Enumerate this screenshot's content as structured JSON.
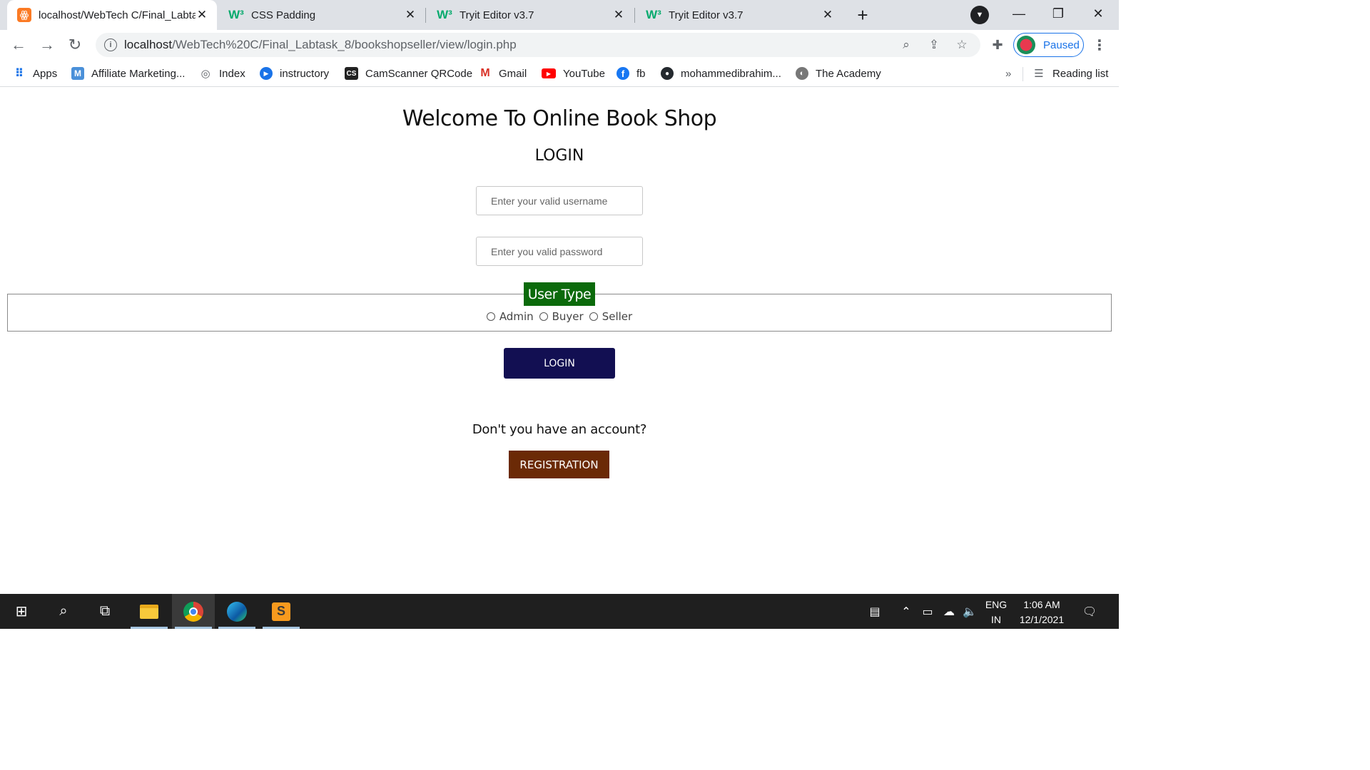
{
  "tabs": [
    {
      "title": "localhost/WebTech C/Final_Labta",
      "favicon": "xampp-icon",
      "active": true
    },
    {
      "title": "CSS Padding",
      "favicon": "w3schools-icon",
      "active": false
    },
    {
      "title": "Tryit Editor v3.7",
      "favicon": "w3schools-icon",
      "active": false
    },
    {
      "title": "Tryit Editor v3.7",
      "favicon": "w3schools-icon",
      "active": false
    }
  ],
  "toolbar": {
    "url_host": "localhost",
    "url_path": "/WebTech%20C/Final_Labtask_8/bookshopseller/view/login.php",
    "profile_label": "Paused"
  },
  "bookmarks": [
    {
      "label": "Apps",
      "icon": "apps-grid-icon"
    },
    {
      "label": "Affiliate Marketing...",
      "icon": "m-icon"
    },
    {
      "label": "Index",
      "icon": "globe-icon"
    },
    {
      "label": "instructory",
      "icon": "play-icon"
    },
    {
      "label": "CamScanner QRCode",
      "icon": "cs-icon"
    },
    {
      "label": "Gmail",
      "icon": "gmail-icon"
    },
    {
      "label": "YouTube",
      "icon": "youtube-icon"
    },
    {
      "label": "fb",
      "icon": "facebook-icon"
    },
    {
      "label": "mohammedibrahim...",
      "icon": "github-icon"
    },
    {
      "label": "The Academy",
      "icon": "globe-icon"
    }
  ],
  "reading_list": "Reading list",
  "page": {
    "welcome": "Welcome To Online Book Shop",
    "login_title": "LOGIN",
    "username_placeholder": "Enter your valid username",
    "password_placeholder": "Enter you valid password",
    "user_type_legend": "User Type",
    "user_types": [
      "Admin",
      "Buyer",
      "Seller"
    ],
    "login_button": "LOGIN",
    "account_question": "Don't you have an account?",
    "registration_button": "REGISTRATION"
  },
  "colors": {
    "legend_bg": "#0b6a0b",
    "login_button_bg": "#120f52",
    "registration_button_bg": "#6b2a06"
  },
  "taskbar": {
    "lang_line1": "ENG",
    "lang_line2": "IN",
    "time": "1:06 AM",
    "date": "12/1/2021"
  }
}
